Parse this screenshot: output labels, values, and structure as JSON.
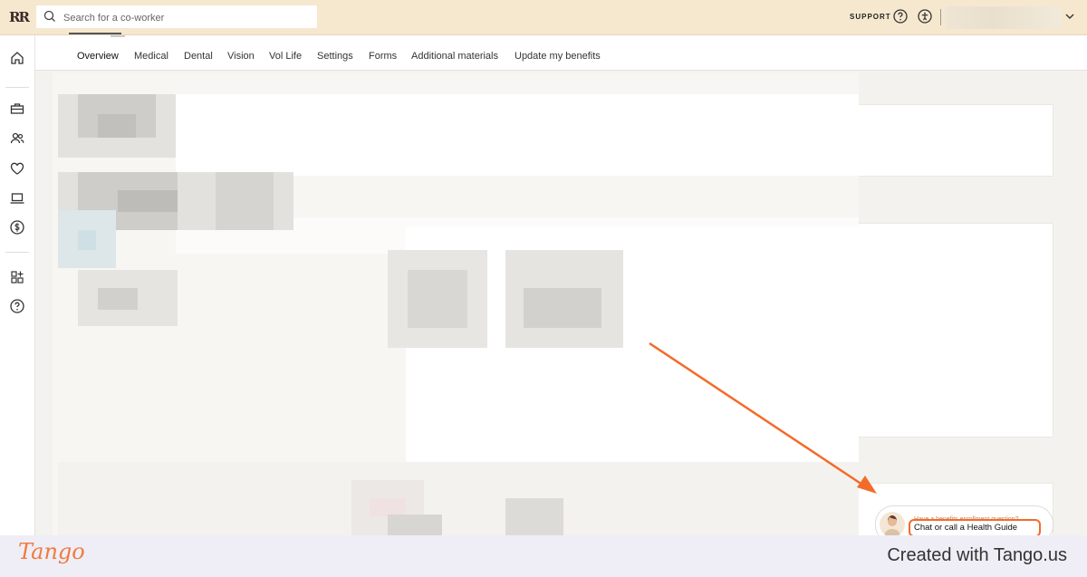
{
  "app": {
    "logo_text": "RR"
  },
  "search": {
    "placeholder": "Search for a co-worker",
    "value": ""
  },
  "header": {
    "support_label": "SUPPORT",
    "account_name": ""
  },
  "sidebar": {
    "items": [
      {
        "icon": "home-icon"
      },
      {
        "icon": "briefcase-icon"
      },
      {
        "icon": "people-icon"
      },
      {
        "icon": "heart-icon"
      },
      {
        "icon": "laptop-icon"
      },
      {
        "icon": "dollar-icon"
      },
      {
        "icon": "apps-add-icon"
      },
      {
        "icon": "help-icon"
      }
    ]
  },
  "tabs": [
    {
      "label": "Overview",
      "active": true
    },
    {
      "label": "Medical"
    },
    {
      "label": "Dental"
    },
    {
      "label": "Vision"
    },
    {
      "label": "Vol Life"
    },
    {
      "label": "Settings"
    },
    {
      "label": "Forms"
    },
    {
      "label": "Additional materials"
    },
    {
      "label": "Update my benefits"
    }
  ],
  "health_guide": {
    "question": "Have a benefits enrollment question?",
    "cta_label": "Chat or call a Health Guide"
  },
  "footer": {
    "brand": "Tango",
    "created_text": "Created with Tango.us"
  },
  "colors": {
    "accent": "#f36b2a",
    "topbar": "#f6e8cf",
    "brand": "#f07b3f"
  }
}
